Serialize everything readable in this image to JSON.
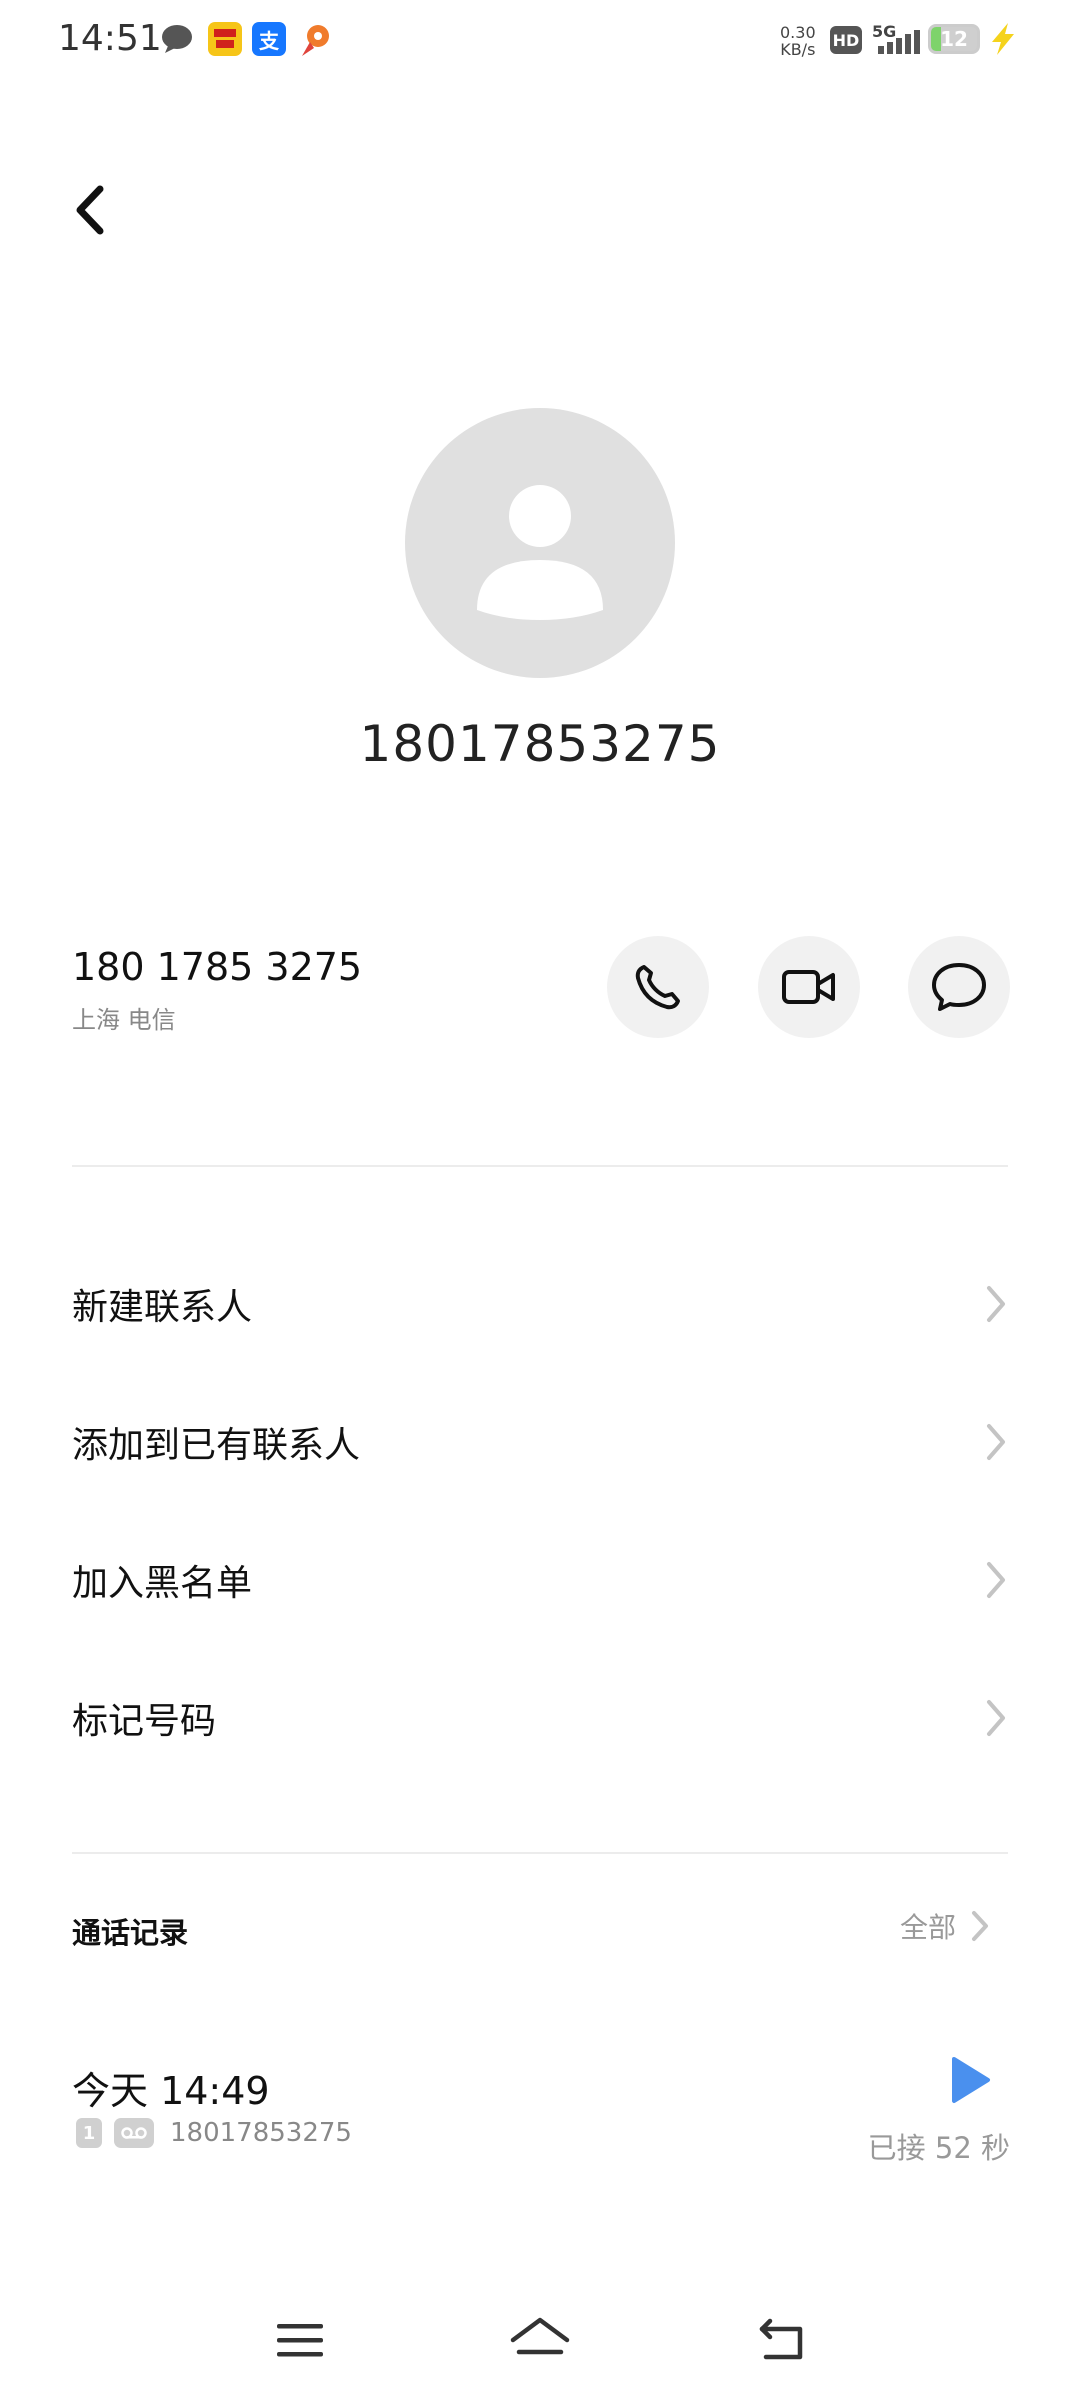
{
  "status_bar": {
    "time": "14:51",
    "net_speed_value": "0.30",
    "net_speed_unit": "KB/s",
    "hd": "HD",
    "network": "5G",
    "battery": "12",
    "notification_icons": [
      "chat-bubble-icon",
      "game-app-icon",
      "alipay-icon",
      "map-pin-icon"
    ],
    "alipay_glyph": "支"
  },
  "header": {
    "back_icon": "chevron-left-icon"
  },
  "contact": {
    "display_number": "18017853275",
    "formatted_number": "180 1785 3275",
    "location": "上海  电信",
    "actions": [
      "phone-icon",
      "video-call-icon",
      "message-icon"
    ]
  },
  "menu": {
    "items": [
      {
        "label": "新建联系人"
      },
      {
        "label": "添加到已有联系人"
      },
      {
        "label": "加入黑名单"
      },
      {
        "label": "标记号码"
      }
    ]
  },
  "call_log": {
    "title": "通话记录",
    "all_label": "全部",
    "entries": [
      {
        "time": "今天 14:49",
        "sim": "1",
        "number": "18017853275",
        "status": "已接 52 秒"
      }
    ]
  },
  "nav_bar": {
    "buttons": [
      "menu-icon",
      "home-icon",
      "back-icon"
    ]
  },
  "colors": {
    "accent": "#4a90ee",
    "avatar_bg": "#e0e0e0",
    "avatar_fg": "#ffffff"
  }
}
